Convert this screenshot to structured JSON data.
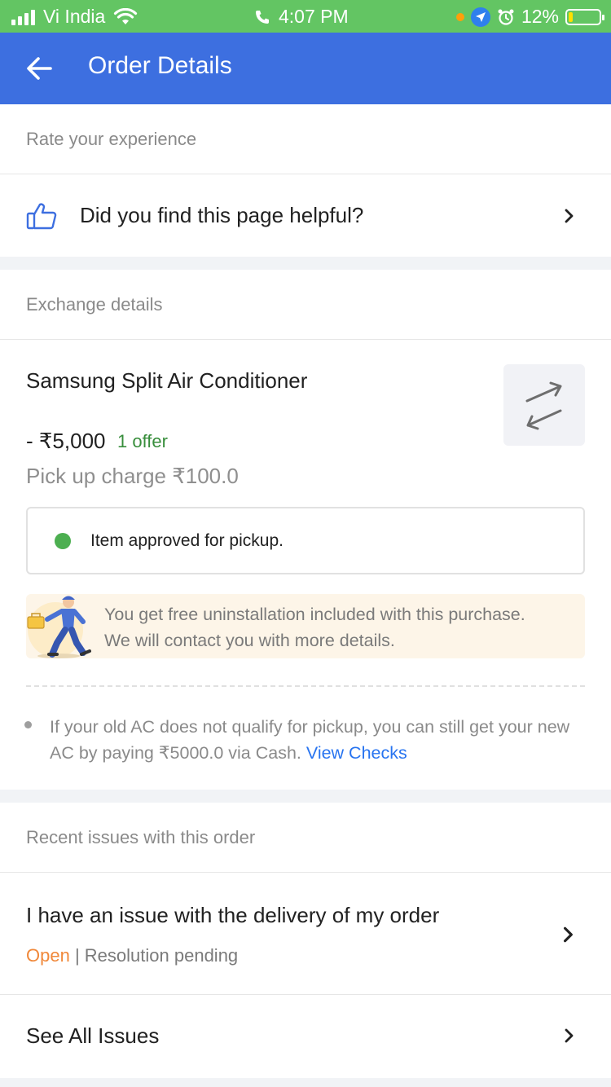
{
  "status_bar": {
    "carrier": "Vi India",
    "time": "4:07 PM",
    "battery": "12%",
    "battery_level": 0.12
  },
  "app_bar": {
    "title": "Order Details"
  },
  "rate_section": {
    "header": "Rate your experience",
    "helpful_label": "Did you find this page helpful?"
  },
  "exchange": {
    "header": "Exchange details",
    "product_name": "Samsung Split Air Conditioner",
    "price": "- ₹5,000",
    "offer": "1 offer",
    "pickup_charge": "Pick up charge ₹100.0",
    "approved_text": "Item approved for pickup.",
    "uninstall_line1": "You get free uninstallation included with this purchase.",
    "uninstall_line2": "We will contact you with more details.",
    "note_text": "If your old AC does not qualify for pickup, you can still get your new AC by paying ₹5000.0 via Cash.",
    "note_link": "View Checks"
  },
  "issues": {
    "header": "Recent issues with this order",
    "issue_title": "I have an issue with the delivery of my order",
    "issue_state": "Open",
    "issue_separator": "|",
    "issue_resolution": "Resolution pending",
    "see_all": "See All Issues"
  },
  "colors": {
    "status_bar": "#63c563",
    "app_bar": "#3d6fe0",
    "offer_green": "#388e3c",
    "link_blue": "#2874f0",
    "open_orange": "#f0883a"
  },
  "icons": {
    "back": "arrow-left-icon",
    "thumbs_up": "thumbs-up-icon",
    "chevron": "chevron-right-icon",
    "swap": "swap-arrows-icon",
    "worker": "delivery-worker-icon"
  }
}
